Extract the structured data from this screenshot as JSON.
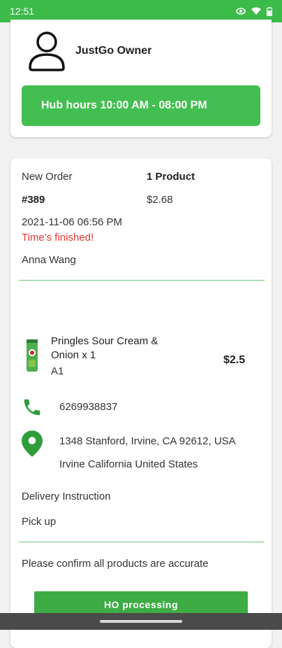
{
  "status_bar": {
    "time": "12:51"
  },
  "owner": {
    "name": "JustGo Owner",
    "hub_hours": "Hub hours 10:00 AM - 08:00 PM"
  },
  "order": {
    "status": "New Order",
    "number": "#389",
    "product_count": "1 Product",
    "total": "$2.68",
    "datetime": "2021-11-06 06:56 PM",
    "timer_note": "Time's finished!",
    "customer": "Anna Wang"
  },
  "product": {
    "name_line1": "Pringles Sour Cream &",
    "name_line2": "Onion x 1",
    "shelf": "A1",
    "price": "$2.5"
  },
  "contact": {
    "phone": "6269938837",
    "address_line1": "1348 Stanford, Irvine, CA 92612, USA",
    "address_line2": "Irvine California United States"
  },
  "delivery": {
    "label": "Delivery Instruction",
    "value": "Pick up"
  },
  "confirm_text": "Please confirm all products are accurate",
  "action_button": "HO processing",
  "colors": {
    "accent": "#3dbb4a",
    "alert": "#e53935"
  },
  "icons": [
    "signal-icon",
    "wifi-icon",
    "battery-icon",
    "user-avatar-icon",
    "phone-icon",
    "location-pin-icon"
  ]
}
